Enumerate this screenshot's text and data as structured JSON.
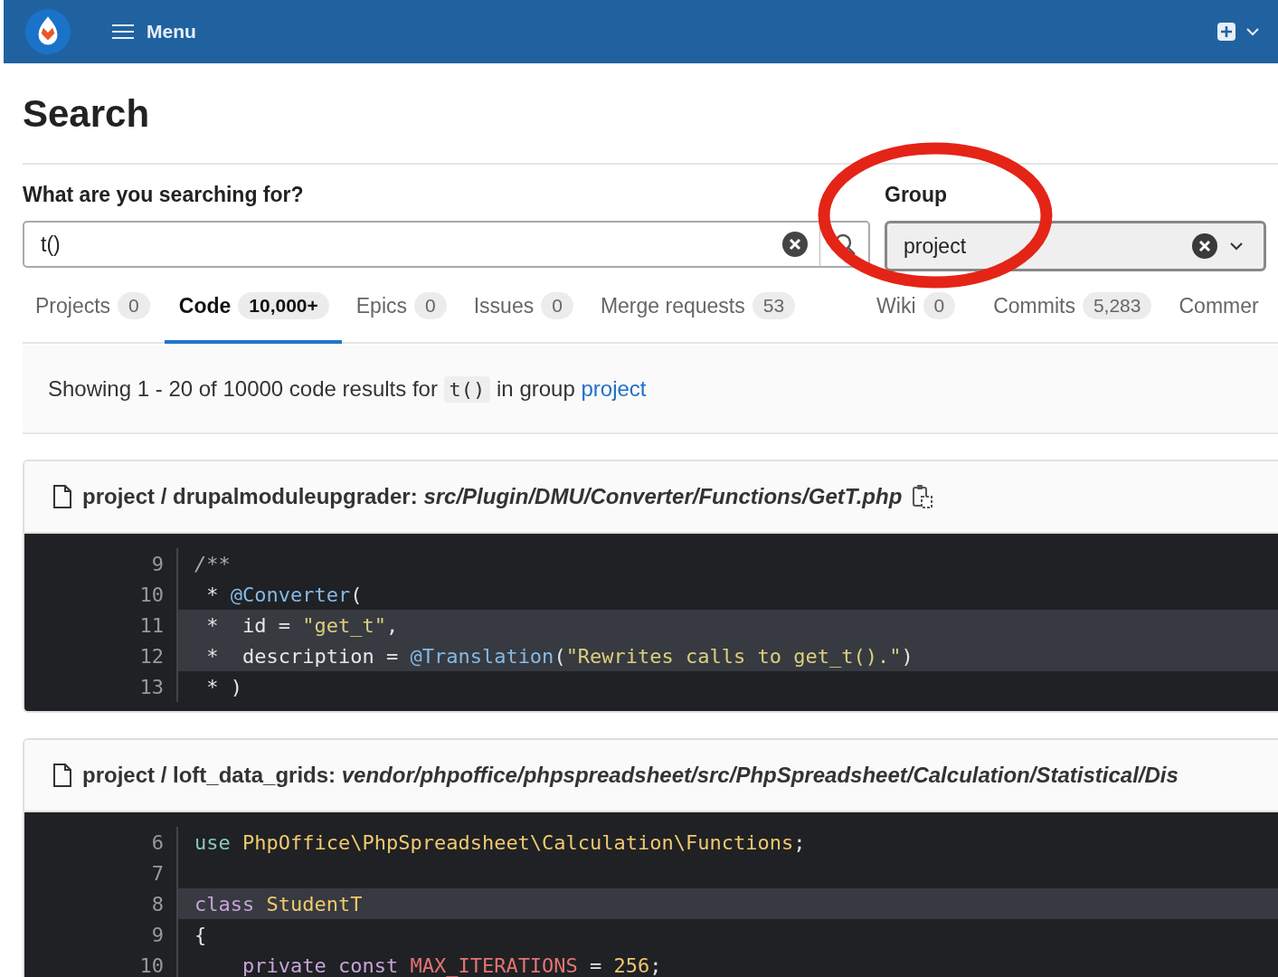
{
  "header": {
    "menu_label": "Menu"
  },
  "page_title": "Search",
  "search": {
    "label": "What are you searching for?",
    "value": "t()"
  },
  "group": {
    "label": "Group",
    "value": "project"
  },
  "tabs": [
    {
      "label": "Projects",
      "count": "0",
      "selected": false
    },
    {
      "label": "Code",
      "count": "10,000+",
      "selected": true
    },
    {
      "label": "Epics",
      "count": "0",
      "selected": false
    },
    {
      "label": "Issues",
      "count": "0",
      "selected": false
    },
    {
      "label": "Merge requests",
      "count": "53",
      "selected": false
    },
    {
      "label": "Wiki",
      "count": "0",
      "selected": false
    },
    {
      "label": "Commits",
      "count": "5,283",
      "selected": false
    },
    {
      "label": "Commer",
      "selected": false
    }
  ],
  "summary": {
    "before": "Showing 1 - 20 of 10000 code results for",
    "query": "t()",
    "middle": "in group",
    "link": "project"
  },
  "results": [
    {
      "project": "project / drupalmoduleupgrader:",
      "path": "src/Plugin/DMU/Converter/Functions/GetT.php",
      "copy": true,
      "lines": [
        {
          "number": "9",
          "highlighted": false,
          "tokens": [
            {
              "kind": "comment",
              "text": "/**"
            }
          ]
        },
        {
          "number": "10",
          "highlighted": false,
          "tokens": [
            {
              "kind": "plain",
              "text": " * "
            },
            {
              "kind": "annotation",
              "text": "@Converter"
            },
            {
              "kind": "plain",
              "text": "("
            }
          ]
        },
        {
          "number": "11",
          "highlighted": true,
          "tokens": [
            {
              "kind": "plain",
              "text": " *  id = "
            },
            {
              "kind": "string",
              "text": "\"get_t\""
            },
            {
              "kind": "plain",
              "text": ","
            }
          ]
        },
        {
          "number": "12",
          "highlighted": true,
          "tokens": [
            {
              "kind": "plain",
              "text": " *  description = "
            },
            {
              "kind": "annotation",
              "text": "@Translation"
            },
            {
              "kind": "plain",
              "text": "("
            },
            {
              "kind": "string",
              "text": "\"Rewrites calls to get_t().\""
            },
            {
              "kind": "plain",
              "text": ")"
            }
          ]
        },
        {
          "number": "13",
          "highlighted": false,
          "tokens": [
            {
              "kind": "plain",
              "text": " * )"
            }
          ]
        }
      ]
    },
    {
      "project": "project / loft_data_grids:",
      "path": "vendor/phpoffice/phpspreadsheet/src/PhpSpreadsheet/Calculation/Statistical/Dis",
      "copy": false,
      "lines": [
        {
          "number": "6",
          "highlighted": false,
          "tokens": [
            {
              "kind": "keyword",
              "text": "use "
            },
            {
              "kind": "classname",
              "text": "PhpOffice\\PhpSpreadsheet\\Calculation\\Functions"
            },
            {
              "kind": "plain",
              "text": ";"
            }
          ]
        },
        {
          "number": "7",
          "highlighted": false
        },
        {
          "number": "8",
          "highlighted": true,
          "tokens": [
            {
              "kind": "storage",
              "text": "class "
            },
            {
              "kind": "classname",
              "text": "StudentT"
            }
          ]
        },
        {
          "number": "9",
          "highlighted": false,
          "tokens": [
            {
              "kind": "plain",
              "text": "{"
            }
          ]
        },
        {
          "number": "10",
          "highlighted": false,
          "tokens": [
            {
              "kind": "storage",
              "text": "    private const "
            },
            {
              "kind": "constant",
              "text": "MAX_ITERATIONS"
            },
            {
              "kind": "plain",
              "text": " = "
            },
            {
              "kind": "number",
              "text": "256"
            },
            {
              "kind": "plain",
              "text": ";"
            }
          ]
        }
      ]
    }
  ]
}
